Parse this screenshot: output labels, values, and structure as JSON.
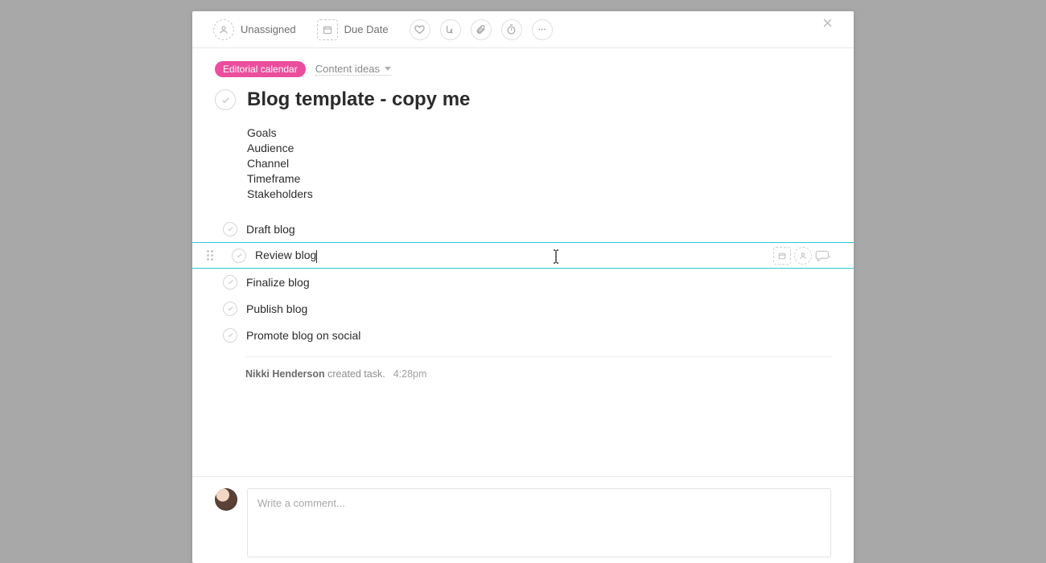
{
  "toolbar": {
    "assignee_label": "Unassigned",
    "due_label": "Due Date"
  },
  "tag": {
    "project": "Editorial calendar",
    "section": "Content ideas"
  },
  "task": {
    "title": "Blog template - copy me",
    "description": [
      "Goals",
      "Audience",
      "Channel",
      "Timeframe",
      "Stakeholders"
    ]
  },
  "subtasks": [
    {
      "name": "Draft blog",
      "active": false
    },
    {
      "name": "Review blog",
      "active": true
    },
    {
      "name": "Finalize blog",
      "active": false
    },
    {
      "name": "Publish blog",
      "active": false
    },
    {
      "name": "Promote blog on social",
      "active": false
    }
  ],
  "activity": {
    "actor": "Nikki Henderson",
    "action": "created task.",
    "time": "4:28pm"
  },
  "comment": {
    "placeholder": "Write a comment..."
  }
}
